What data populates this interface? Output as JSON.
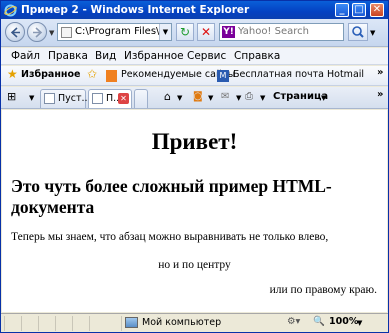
{
  "window": {
    "title": "Пример 2 - Windows Internet Explorer",
    "minimize": "_",
    "maximize": "□",
    "close": "✕"
  },
  "address": {
    "value": "C:\\Program Files\\H",
    "search_placeholder": "Yahoo! Search",
    "search_logo": "Y!"
  },
  "menu": [
    "Файл",
    "Правка",
    "Вид",
    "Избранное",
    "Сервис",
    "Справка"
  ],
  "favorites": {
    "label": "Избранное",
    "items": [
      "Рекомендуемые сайты",
      "Бесплатная почта Hotmail"
    ]
  },
  "tabs": [
    {
      "label": "Пуст..."
    },
    {
      "label": "П..."
    }
  ],
  "commandbar": {
    "page": "Страница"
  },
  "content": {
    "h1": "Привет!",
    "h2": "Это чуть более сложный пример HTML-документа",
    "p_left": "Теперь мы знаем, что абзац можно выравнивать не только влево,",
    "p_center": "но и по центру",
    "p_right": "или по правому краю."
  },
  "status": {
    "zone": "Мой компьютер",
    "zoom": "100%"
  },
  "colors": {
    "titlebar": "#0441c2",
    "window_border": "#0831a8",
    "chrome": "#ece9d8"
  }
}
